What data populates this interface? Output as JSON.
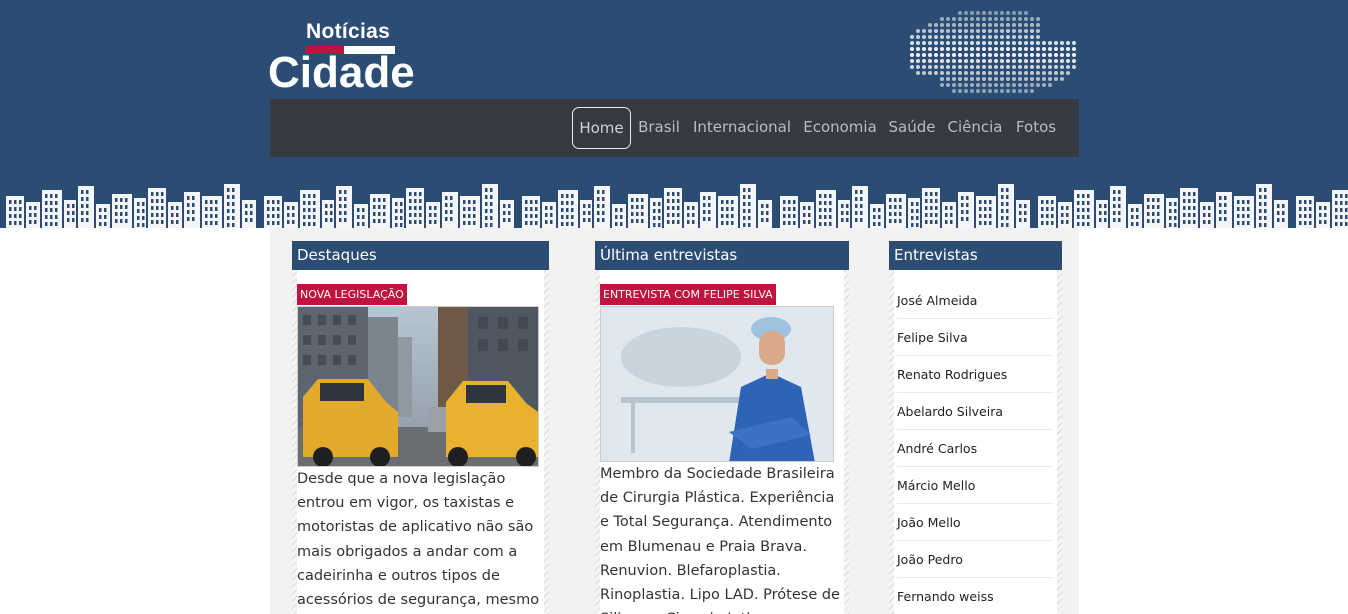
{
  "site": {
    "logo_small": "Notícias",
    "logo_big": "Cidade"
  },
  "nav": {
    "items": [
      "Home",
      "Brasil",
      "Internacional",
      "Economia",
      "Saúde",
      "Ciência",
      "Fotos"
    ],
    "active": "Home"
  },
  "colors": {
    "header_blue": "#2b4c73",
    "nav_dark": "#353a43",
    "tag_red": "#c0133d"
  },
  "destaques": {
    "title": "Destaques",
    "tag": "NOVA LEGISLAÇÃO",
    "text": "Desde que a nova legislação entrou em vigor, os taxistas e motoristas de aplicativo não são mais obrigados a andar com a cadeirinha e outros tipos de acessórios de segurança, mesmo"
  },
  "ultima": {
    "title": "Última entrevistas",
    "tag": "ENTREVISTA COM FELIPE SILVA",
    "text": "Membro da Sociedade Brasileira de Cirurgia Plástica. Experiência e Total Segurança. Atendimento em Blumenau e Praia Brava. Renuvion. Blefaroplastia. Rinoplastia. Lipo LAD. Prótese de Silicone. Cirurgia Intima."
  },
  "entrevistas": {
    "title": "Entrevistas",
    "items": [
      "José Almeida",
      "Felipe Silva",
      "Renato Rodrigues",
      "Abelardo Silveira",
      "André Carlos",
      "Márcio Mello",
      "João Mello",
      "João Pedro",
      "Fernando weiss"
    ]
  }
}
